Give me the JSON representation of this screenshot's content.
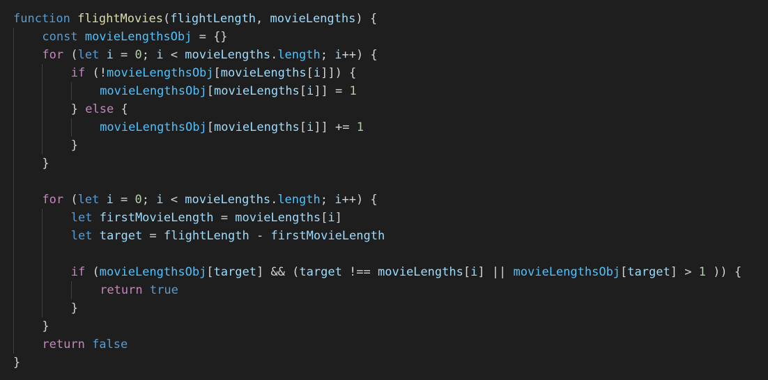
{
  "colors": {
    "background": "#1e1e1e",
    "default": "#d4d4d4",
    "keyword": "#569cd6",
    "control": "#c586c0",
    "function": "#dcdcaa",
    "variable": "#9cdcfe",
    "object": "#4fc1ff",
    "number": "#b5cea8",
    "punctuation": "#d4d4d4"
  },
  "code": {
    "lines": [
      {
        "indent": 0,
        "tokens": [
          {
            "t": "function",
            "k": "keyword"
          },
          {
            "t": " ",
            "k": "default"
          },
          {
            "t": "flightMovies",
            "k": "function"
          },
          {
            "t": "(",
            "k": "default"
          },
          {
            "t": "flightLength",
            "k": "variable"
          },
          {
            "t": ", ",
            "k": "default"
          },
          {
            "t": "movieLengths",
            "k": "variable"
          },
          {
            "t": ") {",
            "k": "default"
          }
        ]
      },
      {
        "indent": 1,
        "tokens": [
          {
            "t": "const",
            "k": "keyword"
          },
          {
            "t": " ",
            "k": "default"
          },
          {
            "t": "movieLengthsObj",
            "k": "object"
          },
          {
            "t": " = {}",
            "k": "default"
          }
        ]
      },
      {
        "indent": 1,
        "tokens": [
          {
            "t": "for",
            "k": "control"
          },
          {
            "t": " (",
            "k": "default"
          },
          {
            "t": "let",
            "k": "keyword"
          },
          {
            "t": " ",
            "k": "default"
          },
          {
            "t": "i",
            "k": "variable"
          },
          {
            "t": " = ",
            "k": "default"
          },
          {
            "t": "0",
            "k": "number"
          },
          {
            "t": "; ",
            "k": "default"
          },
          {
            "t": "i",
            "k": "variable"
          },
          {
            "t": " < ",
            "k": "default"
          },
          {
            "t": "movieLengths",
            "k": "variable"
          },
          {
            "t": ".",
            "k": "default"
          },
          {
            "t": "length",
            "k": "object"
          },
          {
            "t": "; ",
            "k": "default"
          },
          {
            "t": "i",
            "k": "variable"
          },
          {
            "t": "++) {",
            "k": "default"
          }
        ]
      },
      {
        "indent": 2,
        "tokens": [
          {
            "t": "if",
            "k": "control"
          },
          {
            "t": " (!",
            "k": "default"
          },
          {
            "t": "movieLengthsObj",
            "k": "object"
          },
          {
            "t": "[",
            "k": "default"
          },
          {
            "t": "movieLengths",
            "k": "variable"
          },
          {
            "t": "[",
            "k": "default"
          },
          {
            "t": "i",
            "k": "variable"
          },
          {
            "t": "]]) {",
            "k": "default"
          }
        ]
      },
      {
        "indent": 3,
        "tokens": [
          {
            "t": "movieLengthsObj",
            "k": "object"
          },
          {
            "t": "[",
            "k": "default"
          },
          {
            "t": "movieLengths",
            "k": "variable"
          },
          {
            "t": "[",
            "k": "default"
          },
          {
            "t": "i",
            "k": "variable"
          },
          {
            "t": "]] = ",
            "k": "default"
          },
          {
            "t": "1",
            "k": "number"
          }
        ]
      },
      {
        "indent": 2,
        "tokens": [
          {
            "t": "} ",
            "k": "default"
          },
          {
            "t": "else",
            "k": "control"
          },
          {
            "t": " {",
            "k": "default"
          }
        ]
      },
      {
        "indent": 3,
        "tokens": [
          {
            "t": "movieLengthsObj",
            "k": "object"
          },
          {
            "t": "[",
            "k": "default"
          },
          {
            "t": "movieLengths",
            "k": "variable"
          },
          {
            "t": "[",
            "k": "default"
          },
          {
            "t": "i",
            "k": "variable"
          },
          {
            "t": "]] += ",
            "k": "default"
          },
          {
            "t": "1",
            "k": "number"
          }
        ]
      },
      {
        "indent": 2,
        "tokens": [
          {
            "t": "}",
            "k": "default"
          }
        ]
      },
      {
        "indent": 1,
        "tokens": [
          {
            "t": "}",
            "k": "default"
          }
        ]
      },
      {
        "indent": 1,
        "tokens": []
      },
      {
        "indent": 1,
        "tokens": [
          {
            "t": "for",
            "k": "control"
          },
          {
            "t": " (",
            "k": "default"
          },
          {
            "t": "let",
            "k": "keyword"
          },
          {
            "t": " ",
            "k": "default"
          },
          {
            "t": "i",
            "k": "variable"
          },
          {
            "t": " = ",
            "k": "default"
          },
          {
            "t": "0",
            "k": "number"
          },
          {
            "t": "; ",
            "k": "default"
          },
          {
            "t": "i",
            "k": "variable"
          },
          {
            "t": " < ",
            "k": "default"
          },
          {
            "t": "movieLengths",
            "k": "variable"
          },
          {
            "t": ".",
            "k": "default"
          },
          {
            "t": "length",
            "k": "object"
          },
          {
            "t": "; ",
            "k": "default"
          },
          {
            "t": "i",
            "k": "variable"
          },
          {
            "t": "++) {",
            "k": "default"
          }
        ]
      },
      {
        "indent": 2,
        "tokens": [
          {
            "t": "let",
            "k": "keyword"
          },
          {
            "t": " ",
            "k": "default"
          },
          {
            "t": "firstMovieLength",
            "k": "variable"
          },
          {
            "t": " = ",
            "k": "default"
          },
          {
            "t": "movieLengths",
            "k": "variable"
          },
          {
            "t": "[",
            "k": "default"
          },
          {
            "t": "i",
            "k": "variable"
          },
          {
            "t": "]",
            "k": "default"
          }
        ]
      },
      {
        "indent": 2,
        "tokens": [
          {
            "t": "let",
            "k": "keyword"
          },
          {
            "t": " ",
            "k": "default"
          },
          {
            "t": "target",
            "k": "variable"
          },
          {
            "t": " = ",
            "k": "default"
          },
          {
            "t": "flightLength",
            "k": "variable"
          },
          {
            "t": " - ",
            "k": "default"
          },
          {
            "t": "firstMovieLength",
            "k": "variable"
          }
        ]
      },
      {
        "indent": 2,
        "tokens": []
      },
      {
        "indent": 2,
        "tokens": [
          {
            "t": "if",
            "k": "control"
          },
          {
            "t": " (",
            "k": "default"
          },
          {
            "t": "movieLengthsObj",
            "k": "object"
          },
          {
            "t": "[",
            "k": "default"
          },
          {
            "t": "target",
            "k": "variable"
          },
          {
            "t": "] && (",
            "k": "default"
          },
          {
            "t": "target",
            "k": "variable"
          },
          {
            "t": " !== ",
            "k": "default"
          },
          {
            "t": "movieLengths",
            "k": "variable"
          },
          {
            "t": "[",
            "k": "default"
          },
          {
            "t": "i",
            "k": "variable"
          },
          {
            "t": "] || ",
            "k": "default"
          },
          {
            "t": "movieLengthsObj",
            "k": "object"
          },
          {
            "t": "[",
            "k": "default"
          },
          {
            "t": "target",
            "k": "variable"
          },
          {
            "t": "] > ",
            "k": "default"
          },
          {
            "t": "1",
            "k": "number"
          },
          {
            "t": " )) {",
            "k": "default"
          }
        ]
      },
      {
        "indent": 3,
        "tokens": [
          {
            "t": "return",
            "k": "control"
          },
          {
            "t": " ",
            "k": "default"
          },
          {
            "t": "true",
            "k": "keyword"
          }
        ]
      },
      {
        "indent": 2,
        "tokens": [
          {
            "t": "}",
            "k": "default"
          }
        ]
      },
      {
        "indent": 1,
        "tokens": [
          {
            "t": "}",
            "k": "default"
          }
        ]
      },
      {
        "indent": 1,
        "tokens": [
          {
            "t": "return",
            "k": "control"
          },
          {
            "t": " ",
            "k": "default"
          },
          {
            "t": "false",
            "k": "keyword"
          }
        ]
      },
      {
        "indent": 0,
        "tokens": [
          {
            "t": "}",
            "k": "default"
          }
        ]
      }
    ]
  }
}
